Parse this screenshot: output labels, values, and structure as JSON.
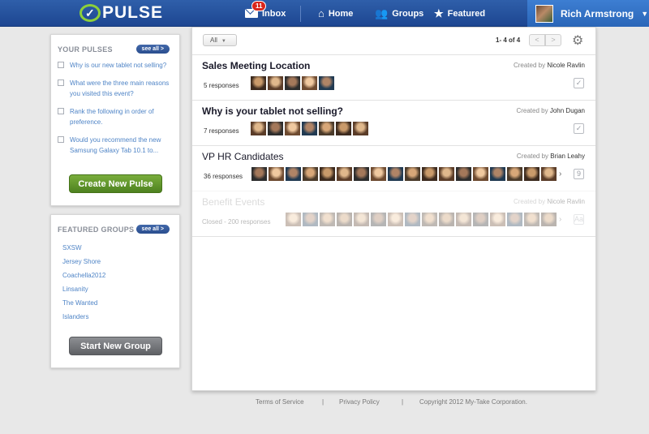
{
  "app": {
    "name": "PULSE"
  },
  "nav": {
    "inbox_label": "Inbox",
    "inbox_badge": "11",
    "home_label": "Home",
    "groups_label": "Groups",
    "featured_label": "Featured"
  },
  "user": {
    "name": "Rich Armstrong"
  },
  "your_pulses": {
    "title": "YOUR PULSES",
    "see_all": "see all >",
    "items": [
      "Why is our new tablet not selling?",
      "What were the three main reasons you visited this event?",
      "Rank the following in order of preference.",
      "Would you recommend the new Samsung Galaxy Tab 10.1 to..."
    ],
    "create_button": "Create New Pulse"
  },
  "featured_groups": {
    "title": "FEATURED GROUPS",
    "see_all": "see all >",
    "items": [
      "SXSW",
      "Jersey Shore",
      "Coachella2012",
      "Linsanity",
      "The Wanted",
      "Islanders"
    ],
    "start_button": "Start New Group"
  },
  "main": {
    "filter": "All",
    "pager": "1- 4 of 4",
    "prev": "<",
    "next": ">",
    "pulses": [
      {
        "title": "Sales Meeting Location",
        "created_prefix": "Created by",
        "creator": "Nicole Ravlin",
        "responses": "5 responses",
        "thumb_count": 5,
        "type_icon": "checkbox-icon",
        "state": "active"
      },
      {
        "title": "Why is your tablet not selling?",
        "created_prefix": "Created by",
        "creator": "John Dugan",
        "responses": "7 responses",
        "thumb_count": 7,
        "type_icon": "checkbox-icon",
        "state": "active"
      },
      {
        "title": "VP HR Candidates",
        "created_prefix": "Created by",
        "creator": "Brian Leahy",
        "responses": "36 responses",
        "thumb_count": 18,
        "type_icon": "rank-icon",
        "state": "active"
      },
      {
        "title": "Benefit Events",
        "created_prefix": "Created by",
        "creator": "Nicole Ravlin",
        "responses": "Closed -  200 responses",
        "thumb_count": 16,
        "type_icon": "text-icon",
        "state": "closed"
      }
    ]
  },
  "footer": {
    "terms": "Terms of Service",
    "privacy": "Privacy Policy",
    "copyright": "Copyright 2012 My-Take Corporation.",
    "separator": "|"
  },
  "colors": {
    "topbar": "#1d4691",
    "user_bar": "#2a66b8",
    "accent_green": "#8ccf3a",
    "create_button": "#5a8d27",
    "group_button": "#6f7175",
    "link_blue": "#4f84c6",
    "badge_red": "#d9261c"
  }
}
